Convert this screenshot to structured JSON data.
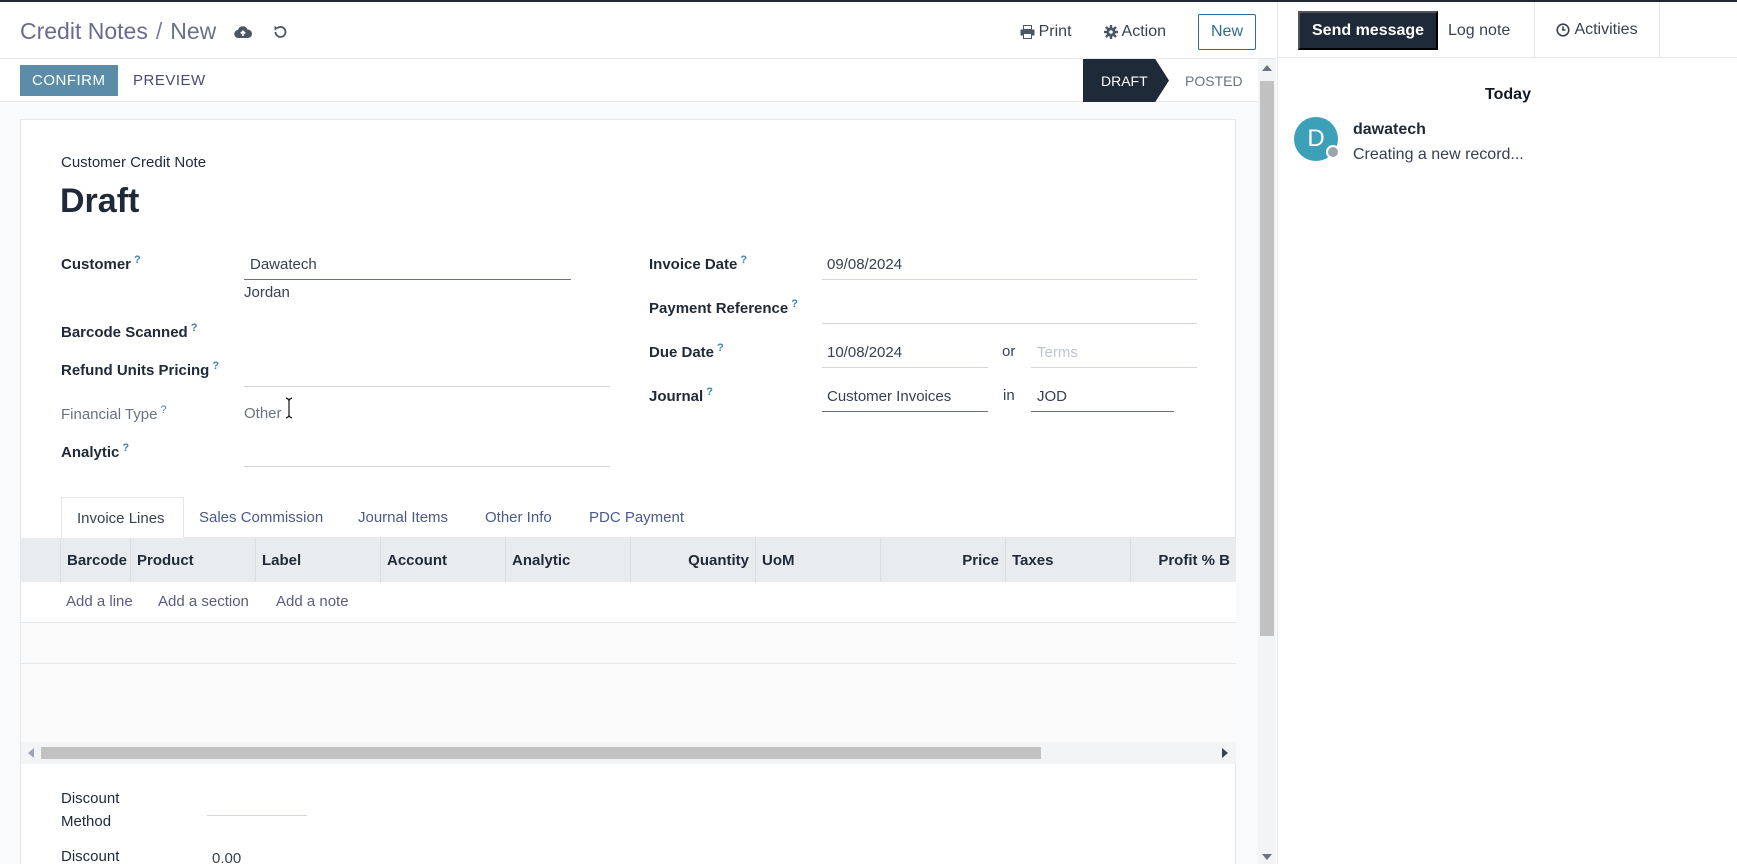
{
  "breadcrumb": {
    "parent": "Credit Notes",
    "separator": "/",
    "current": "New"
  },
  "control_panel": {
    "print": "Print",
    "action": "Action",
    "new": "New"
  },
  "statusbar": {
    "confirm": "CONFIRM",
    "preview": "PREVIEW",
    "stages": [
      "DRAFT",
      "POSTED"
    ],
    "active_stage": "DRAFT"
  },
  "form": {
    "type_label": "Customer Credit Note",
    "title": "Draft",
    "help_mark": "?",
    "customer": {
      "label": "Customer",
      "value": "Dawatech",
      "sub": "Jordan"
    },
    "barcode": {
      "label": "Barcode Scanned"
    },
    "refund": {
      "label": "Refund Units Pricing"
    },
    "financial_type": {
      "label": "Financial Type",
      "value": "Other"
    },
    "analytic": {
      "label": "Analytic"
    },
    "invoice_date": {
      "label": "Invoice Date",
      "value": "09/08/2024"
    },
    "payment_ref": {
      "label": "Payment Reference"
    },
    "due_date": {
      "label": "Due Date",
      "value": "10/08/2024",
      "or": "or",
      "terms_placeholder": "Terms"
    },
    "journal": {
      "label": "Journal",
      "value": "Customer Invoices",
      "in": "in",
      "currency": "JOD"
    },
    "discount_method": {
      "label_line1": "Discount",
      "label_line2": "Method"
    },
    "discount": {
      "label": "Discount",
      "value": "0.00"
    }
  },
  "tabs": [
    "Invoice Lines",
    "Sales Commission",
    "Journal Items",
    "Other Info",
    "PDC Payment"
  ],
  "table": {
    "columns": [
      "Barcode",
      "Product",
      "Label",
      "Account",
      "Analytic",
      "Quantity",
      "UoM",
      "Price",
      "Taxes",
      "Profit % B"
    ],
    "actions": [
      "Add a line",
      "Add a section",
      "Add a note"
    ]
  },
  "chatter": {
    "send": "Send message",
    "log": "Log note",
    "activities": "Activities",
    "date_header": "Today",
    "message": {
      "avatar_letter": "D",
      "author": "dawatech",
      "text": "Creating a new record..."
    }
  },
  "colors": {
    "primary": "#5b8da8",
    "dark": "#1e2a38",
    "avatar": "#3ba0b8",
    "link": "#4b5a8a"
  }
}
